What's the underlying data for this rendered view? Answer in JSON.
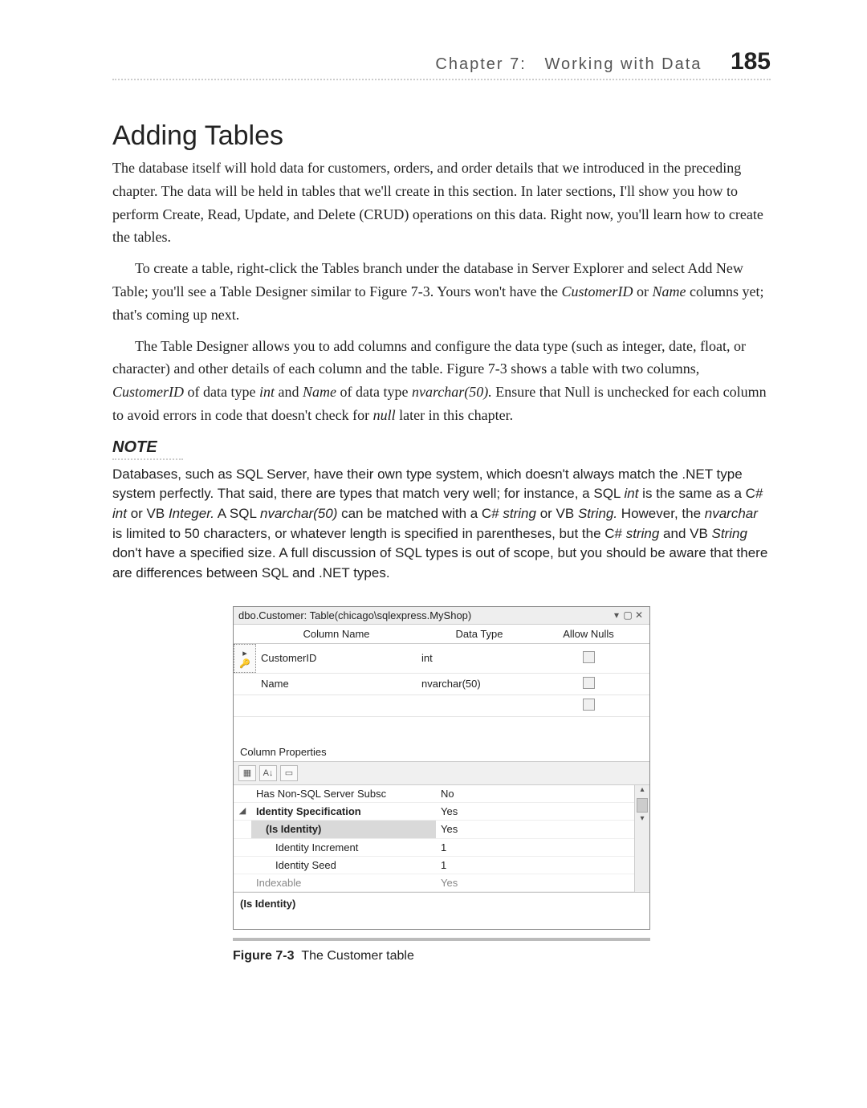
{
  "running_head": {
    "chapter": "Chapter 7:",
    "title": "Working with Data",
    "page": "185"
  },
  "section_title": "Adding Tables",
  "paragraphs": {
    "p1": "The database itself will hold data for customers, orders, and order details that we introduced in the preceding chapter. The data will be held in tables that we'll create in this section. In later sections, I'll show you how to perform Create, Read, Update, and Delete (CRUD) operations on this data. Right now, you'll learn how to create the tables.",
    "p2a": "To create a table, right-click the Tables branch under the database in Server Explorer and select Add New Table; you'll see a Table Designer similar to Figure 7-3. Yours won't have the ",
    "p2b": " or ",
    "p2c": " columns yet; that's coming up next.",
    "em_customerid": "CustomerID",
    "em_name": "Name",
    "p3a": "The Table Designer allows you to add columns and configure the data type (such as integer, date, float, or character) and other details of each column and the table. Figure 7-3 shows a table with two columns, ",
    "p3b": " of data type ",
    "p3c": " and ",
    "p3d": " of data type ",
    "p3e": " Ensure that Null is unchecked for each column to avoid errors in code that doesn't check for ",
    "p3f": " later in this chapter.",
    "em_int": "int",
    "em_nvarchar50": "nvarchar(50).",
    "em_null": "null"
  },
  "note": {
    "head": "NOTE",
    "b1": "Databases, such as SQL Server, have their own type system, which doesn't always match the .NET type system perfectly. That said, there are types that match very well; for instance, a SQL ",
    "em_int": "int",
    "b2": " is the same as a C# ",
    "b3": " or VB ",
    "em_integer": "Integer.",
    "b4": " A SQL ",
    "em_nv50": "nvarchar(50)",
    "b5": " can be matched with a C# ",
    "em_string_l": "string",
    "b6": " or VB ",
    "em_string_u": "String.",
    "b7": " However, the ",
    "em_nv": "nvarchar",
    "b8": " is limited to 50 characters, or whatever length is specified in parentheses, but the C# ",
    "b9": " and VB ",
    "em_string_u2": "String",
    "b10": " don't have a specified size. A full discussion of SQL types is out of scope, but you should be aware that there are differences between SQL and .NET types."
  },
  "designer": {
    "title": "dbo.Customer: Table(chicago\\sqlexpress.MyShop)",
    "headers": {
      "col": "Column Name",
      "dtype": "Data Type",
      "nulls": "Allow Nulls"
    },
    "rows": [
      {
        "key_icon": "▸🔑",
        "name": "CustomerID",
        "dtype": "int"
      },
      {
        "key_icon": "",
        "name": "Name",
        "dtype": "nvarchar(50)"
      },
      {
        "key_icon": "",
        "name": "",
        "dtype": ""
      }
    ],
    "props_title": "Column Properties",
    "toolbar": {
      "b1": "▦",
      "b2": "A↓",
      "b3": "▭"
    },
    "props": [
      {
        "arrow": "",
        "k": "Has Non-SQL Server Subsc",
        "v": "No",
        "dd": "",
        "cls": ""
      },
      {
        "arrow": "◢",
        "k": "Identity Specification",
        "v": "Yes",
        "dd": "",
        "cls": "bold"
      },
      {
        "arrow": "",
        "k": "(Is Identity)",
        "v": "Yes",
        "dd": "▾",
        "cls": "hl"
      },
      {
        "arrow": "",
        "k": "Identity Increment",
        "v": "1",
        "dd": "",
        "cls": "sub"
      },
      {
        "arrow": "",
        "k": "Identity Seed",
        "v": "1",
        "dd": "",
        "cls": "sub"
      },
      {
        "arrow": "",
        "k": "Indexable",
        "v": "Yes",
        "dd": "",
        "cls": "dim"
      }
    ],
    "desc": "(Is Identity)"
  },
  "caption": {
    "label": "Figure 7-3",
    "text": "The Customer table"
  }
}
